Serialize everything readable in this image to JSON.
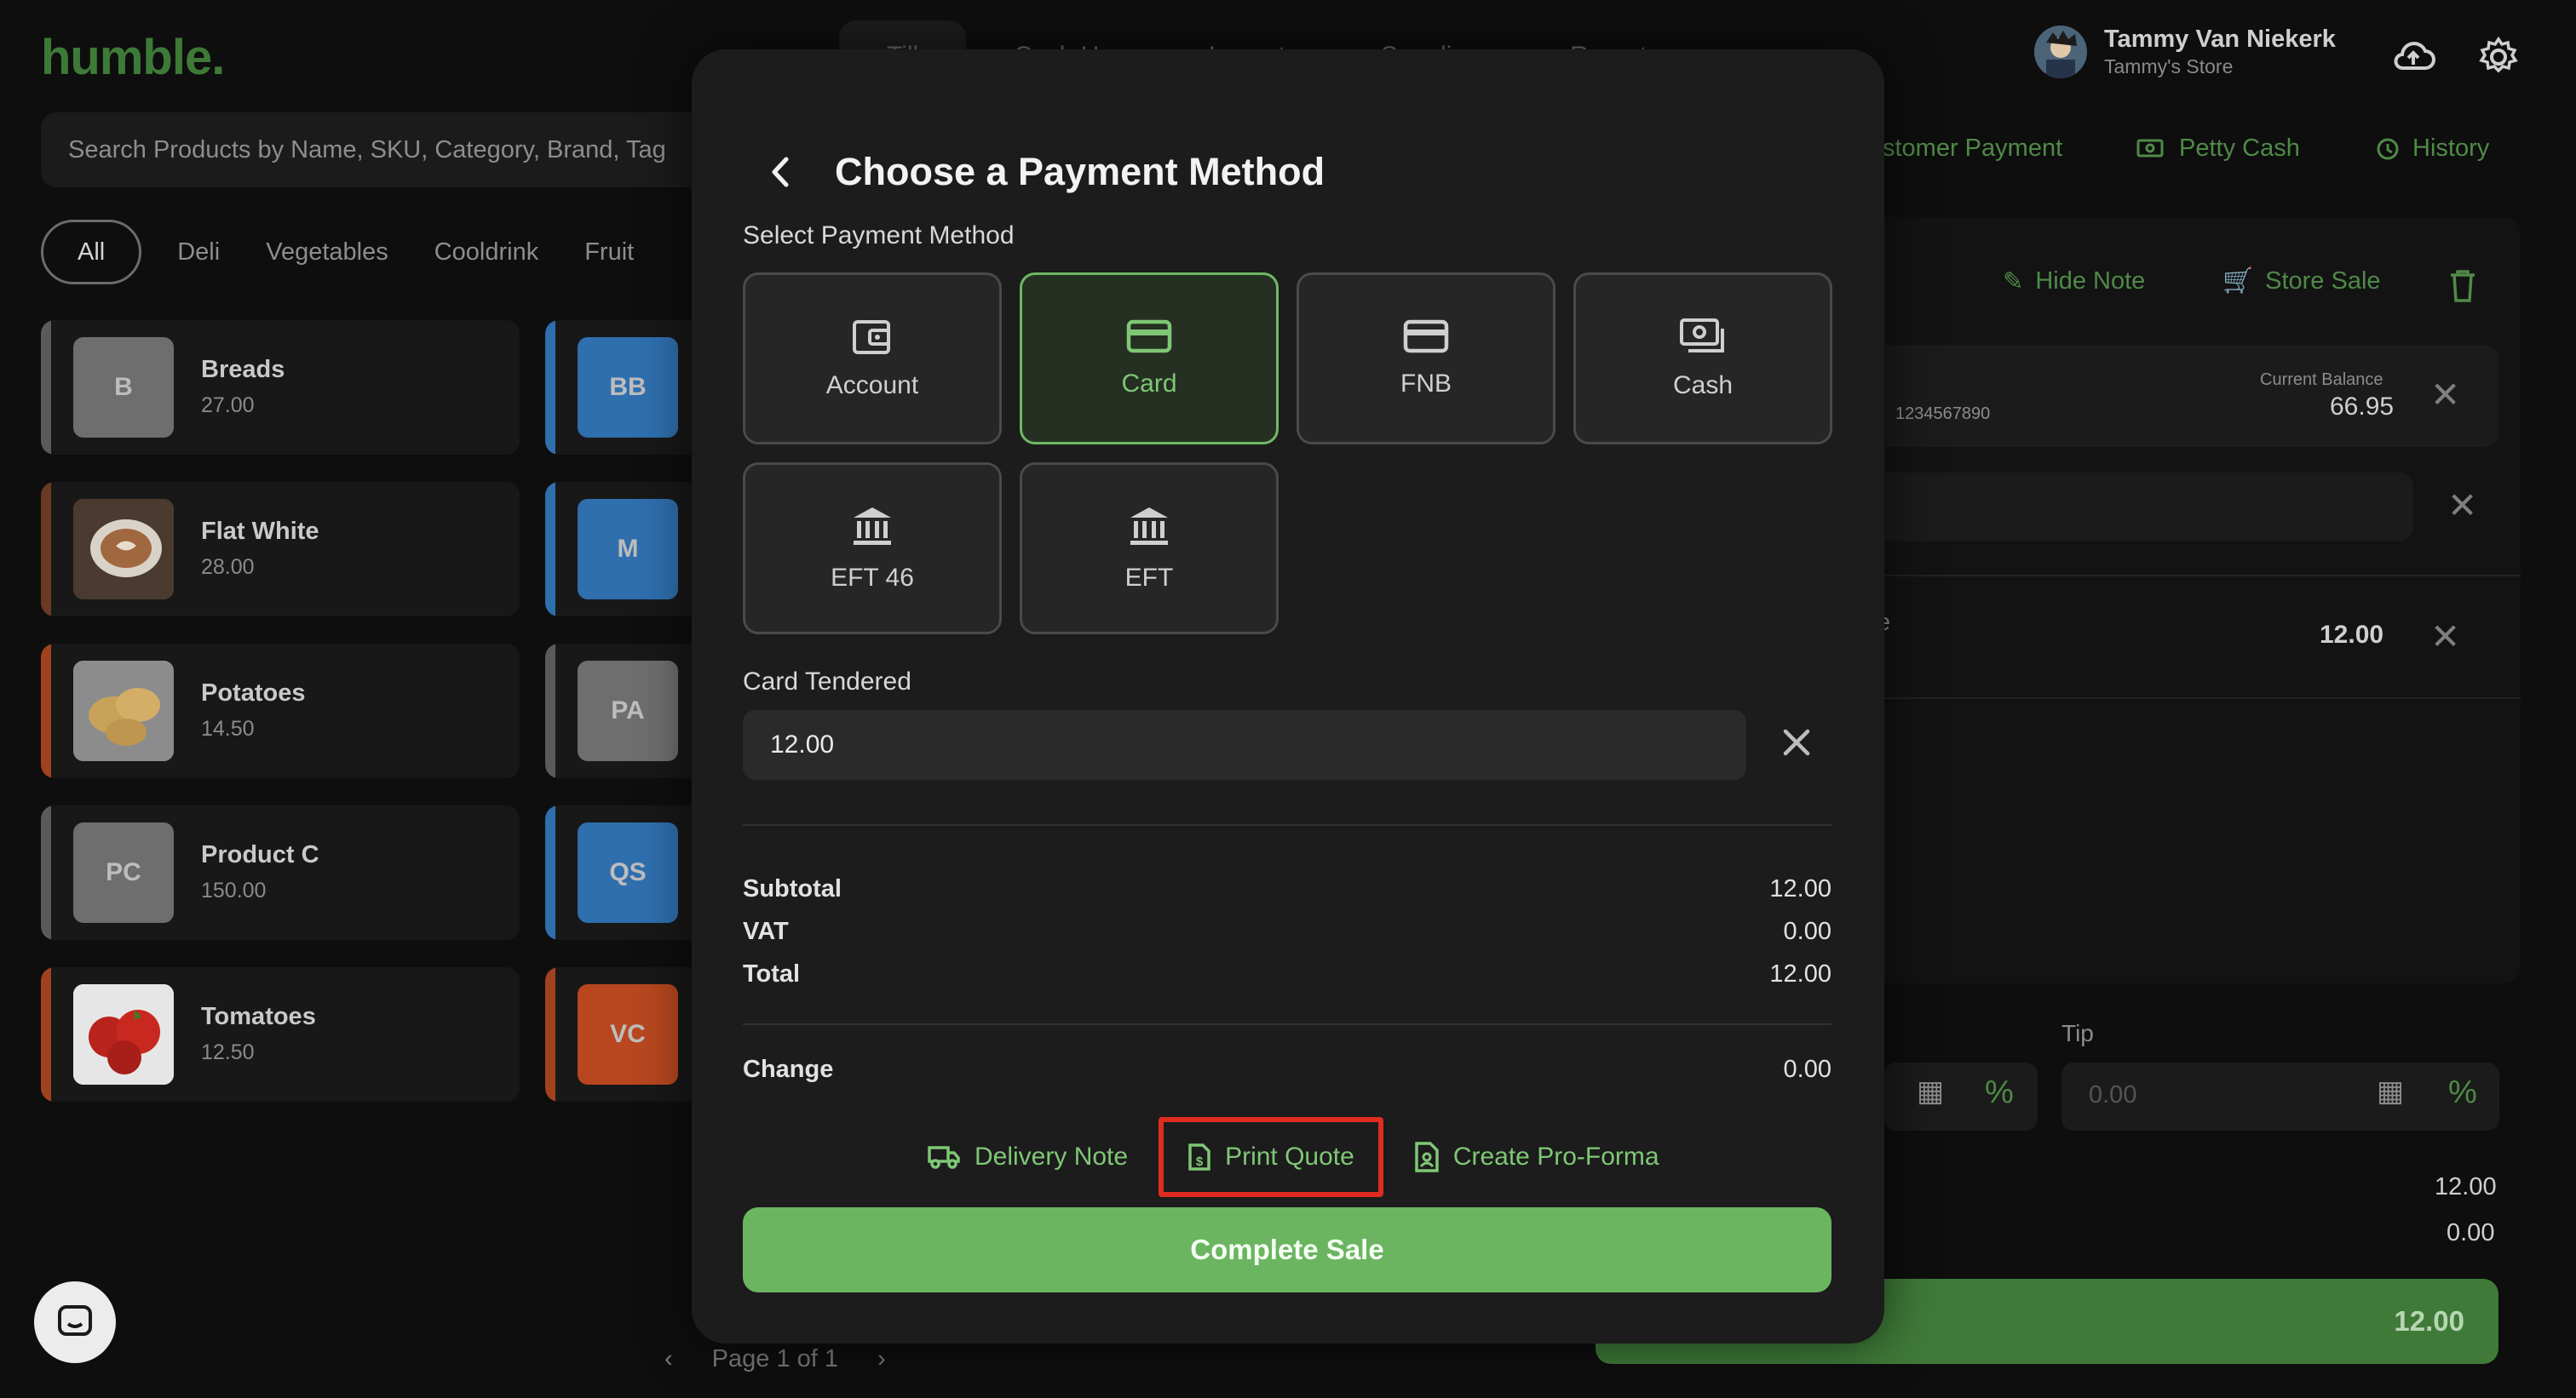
{
  "app": {
    "logo": "humble.",
    "nav_tabs": [
      "Till",
      "Cash Up",
      "Layout",
      "Supplier",
      "Reports"
    ],
    "search_placeholder": "Search Products by Name, SKU, Category, Brand, Tag",
    "categories": [
      "All",
      "Deli",
      "Vegetables",
      "Cooldrink",
      "Fruit"
    ],
    "products": [
      {
        "name": "Breads",
        "price": "27.00",
        "thumb": "B"
      },
      {
        "name": "Flat White",
        "price": "28.00",
        "thumb": ""
      },
      {
        "name": "Potatoes",
        "price": "14.50",
        "thumb": ""
      },
      {
        "name": "Product C",
        "price": "150.00",
        "thumb": "PC"
      },
      {
        "name": "Tomatoes",
        "price": "12.50",
        "thumb": ""
      }
    ],
    "products_col2": [
      "BB",
      "M",
      "PA",
      "QS",
      "VC"
    ],
    "pager": "Page 1 of 1",
    "user": {
      "name": "Tammy Van Niekerk",
      "store": "Tammy's Store"
    },
    "quick_links": {
      "customer_payment": "stomer Payment",
      "petty_cash": "Petty Cash",
      "history": "History"
    },
    "cart": {
      "hide_note": "Hide Note",
      "store_sale": "Store Sale",
      "customer_number": "1234567890",
      "current_balance_label": "Current Balance",
      "current_balance": "66.95",
      "line_fragment": "e",
      "line_amount": "12.00",
      "tip_label": "Tip",
      "tip_placeholder": "0.00",
      "subtotal": "12.00",
      "vat": "0.00",
      "total_button": "12.00"
    },
    "colors": {
      "accent_green": "#6bb561",
      "highlight_red": "#e02c20",
      "modal_bg": "#1c1c1c"
    }
  },
  "modal": {
    "title": "Choose a Payment Method",
    "select_label": "Select Payment Method",
    "methods": [
      {
        "label": "Account",
        "icon": "wallet-icon"
      },
      {
        "label": "Card",
        "icon": "credit-card-icon",
        "selected": true
      },
      {
        "label": "FNB",
        "icon": "credit-card-icon"
      },
      {
        "label": "Cash",
        "icon": "cash-icon"
      },
      {
        "label": "EFT 46",
        "icon": "bank-icon"
      },
      {
        "label": "EFT",
        "icon": "bank-icon"
      }
    ],
    "tendered_label": "Card Tendered",
    "tendered_value": "12.00",
    "subtotal_label": "Subtotal",
    "subtotal": "12.00",
    "vat_label": "VAT",
    "vat": "0.00",
    "total_label": "Total",
    "total": "12.00",
    "change_label": "Change",
    "change": "0.00",
    "actions": {
      "delivery_note": "Delivery Note",
      "print_quote": "Print Quote",
      "pro_forma": "Create Pro-Forma"
    },
    "complete_label": "Complete Sale"
  }
}
